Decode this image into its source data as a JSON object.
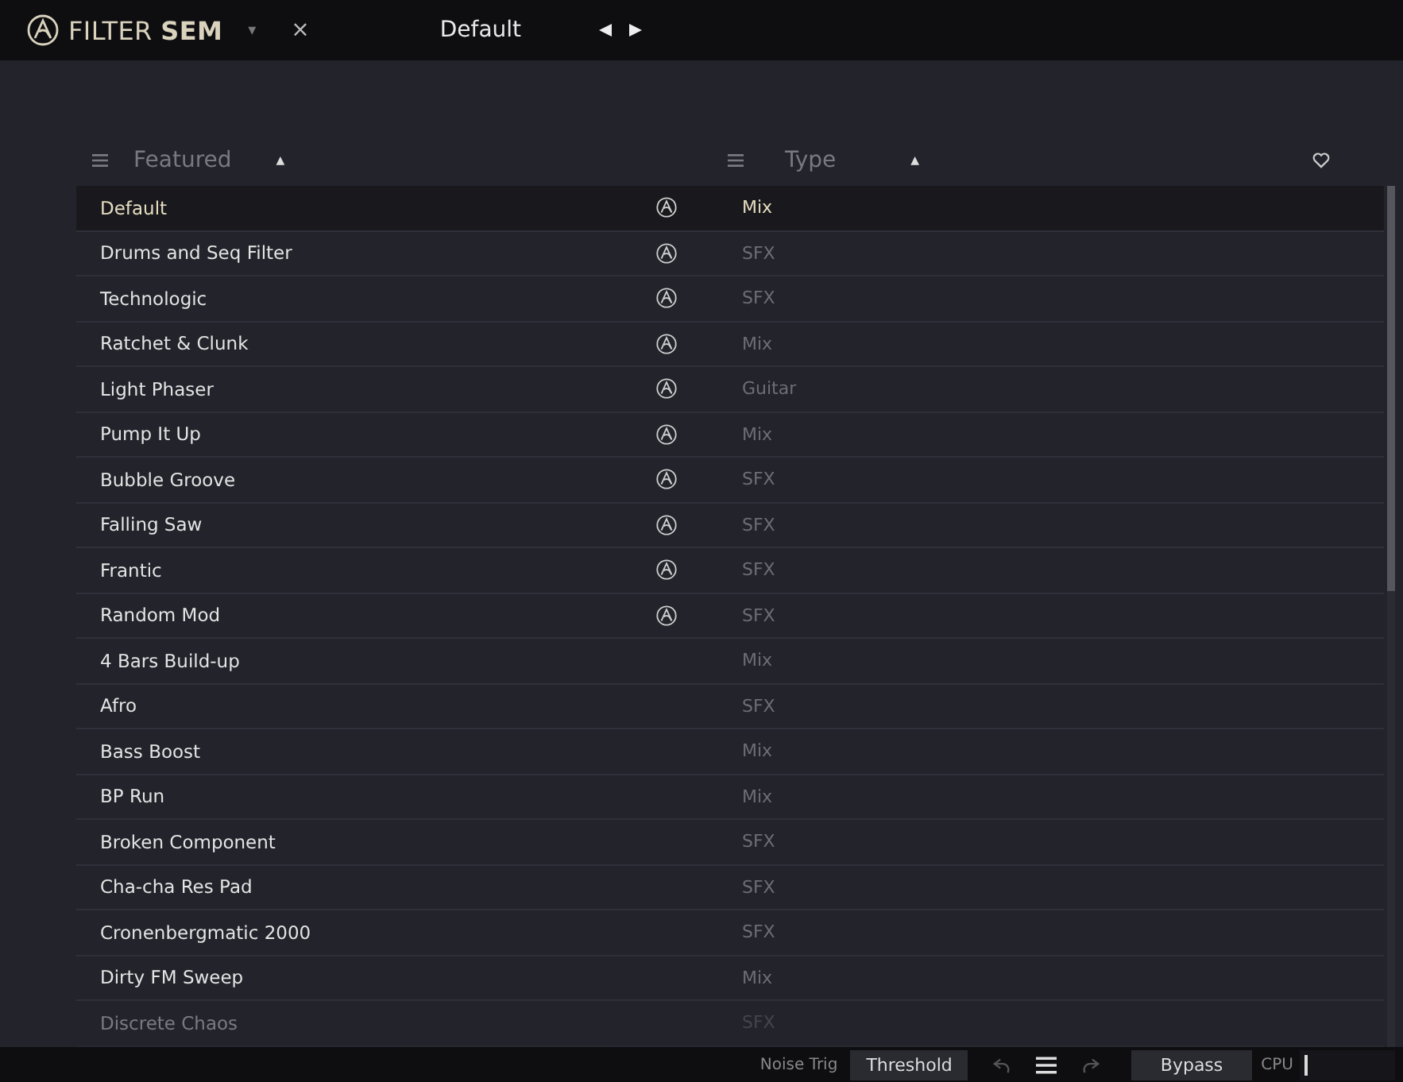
{
  "top_bar": {
    "brand_light": "FILTER",
    "brand_bold": "SEM",
    "dropdown_arrow": "▾",
    "close": "×",
    "preset_name": "Default"
  },
  "columns": [
    {
      "title": "Featured",
      "sort_arrow": "▲"
    },
    {
      "title": "Type",
      "sort_arrow": "▲"
    }
  ],
  "presets": [
    {
      "name": "Default",
      "type": "Mix",
      "featured": true,
      "selected": true,
      "faded": false
    },
    {
      "name": "Drums and Seq Filter",
      "type": "SFX",
      "featured": true,
      "selected": false,
      "faded": false
    },
    {
      "name": "Technologic",
      "type": "SFX",
      "featured": true,
      "selected": false,
      "faded": false
    },
    {
      "name": "Ratchet & Clunk",
      "type": "Mix",
      "featured": true,
      "selected": false,
      "faded": false
    },
    {
      "name": "Light Phaser",
      "type": "Guitar",
      "featured": true,
      "selected": false,
      "faded": false
    },
    {
      "name": "Pump It Up",
      "type": "Mix",
      "featured": true,
      "selected": false,
      "faded": false
    },
    {
      "name": "Bubble Groove",
      "type": "SFX",
      "featured": true,
      "selected": false,
      "faded": false
    },
    {
      "name": "Falling Saw",
      "type": "SFX",
      "featured": true,
      "selected": false,
      "faded": false
    },
    {
      "name": "Frantic",
      "type": "SFX",
      "featured": true,
      "selected": false,
      "faded": false
    },
    {
      "name": "Random Mod",
      "type": "SFX",
      "featured": true,
      "selected": false,
      "faded": false
    },
    {
      "name": "4 Bars Build-up",
      "type": "Mix",
      "featured": false,
      "selected": false,
      "faded": false
    },
    {
      "name": "Afro",
      "type": "SFX",
      "featured": false,
      "selected": false,
      "faded": false
    },
    {
      "name": "Bass Boost",
      "type": "Mix",
      "featured": false,
      "selected": false,
      "faded": false
    },
    {
      "name": "BP Run",
      "type": "Mix",
      "featured": false,
      "selected": false,
      "faded": false
    },
    {
      "name": "Broken Component",
      "type": "SFX",
      "featured": false,
      "selected": false,
      "faded": false
    },
    {
      "name": "Cha-cha Res Pad",
      "type": "SFX",
      "featured": false,
      "selected": false,
      "faded": false
    },
    {
      "name": "Cronenbergmatic 2000",
      "type": "SFX",
      "featured": false,
      "selected": false,
      "faded": false
    },
    {
      "name": "Dirty FM Sweep",
      "type": "Mix",
      "featured": false,
      "selected": false,
      "faded": false
    },
    {
      "name": "Discrete Chaos",
      "type": "SFX",
      "featured": false,
      "selected": false,
      "faded": true
    }
  ],
  "status_bar": {
    "param_label": "Noise Trig",
    "param_value": "Threshold",
    "bypass": "Bypass",
    "cpu_label": "CPU",
    "cpu": {
      "level": 0.04
    }
  }
}
